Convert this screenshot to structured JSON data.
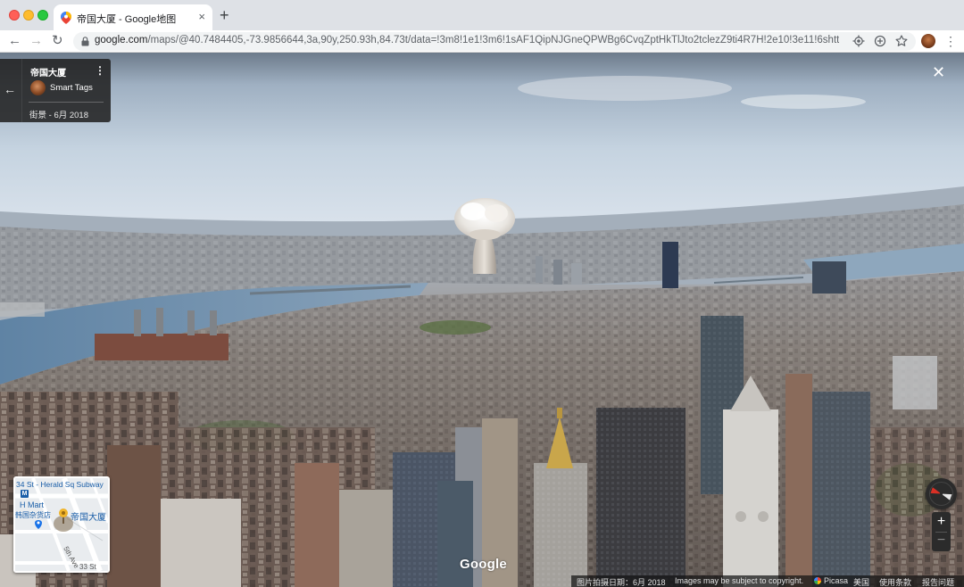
{
  "browser": {
    "tab_title": "帝国大厦 - Google地图",
    "tab_close": "×",
    "new_tab": "+",
    "nav": {
      "back": "←",
      "forward": "→",
      "reload": "↻"
    },
    "url_host": "google.com",
    "url_path": "/maps/@40.7484405,-73.9856644,3a,90y,250.93h,84.73t/data=!3m8!1e1!3m6!1sAF1QipNJGneQPWBg6CvqZptHkTlJto2tclezZ9ti4R7H!2e10!3e11!6shttps...",
    "menu": "⋮"
  },
  "street_view": {
    "place_title": "帝国大厦",
    "card_menu": "⋮",
    "back_arrow": "←",
    "contributor": "Smart Tags",
    "capture_date": "街景 - 6月 2018",
    "close": "✕",
    "zoom_in": "+",
    "zoom_out": "−",
    "google_logo": "Google"
  },
  "minimap": {
    "subway": "34 St - Herald Sq Subway",
    "metro": "M",
    "hmart": "H Mart",
    "store": "韩国杂货店",
    "place": "帝国大厦",
    "street_5th": "5th Ave",
    "street_33": "33 St"
  },
  "footer": {
    "photo_date": "图片拍摄日期：6月 2018",
    "copyright": "Images may be subject to copyright.",
    "picasa": "Picasa",
    "region": "美国",
    "terms": "使用条款",
    "report": "报告问题"
  },
  "colors": {
    "sky_top": "#6d7b8b",
    "sky_haze": "#dce4ed",
    "river": "#6a8aa8",
    "city": "#8c8680",
    "chrome": "#dee1e6"
  }
}
